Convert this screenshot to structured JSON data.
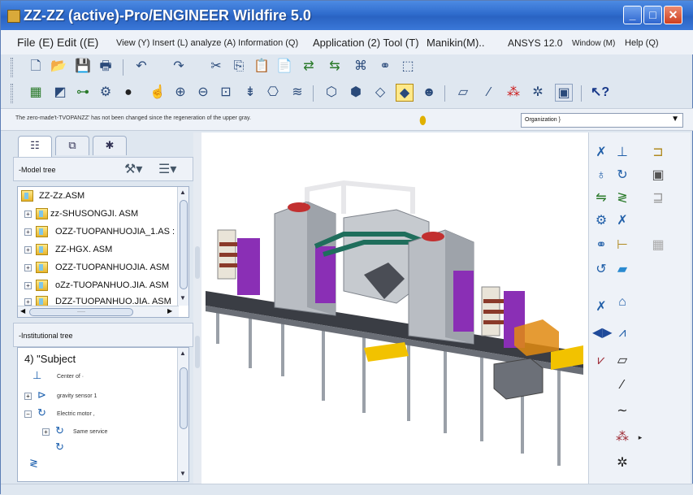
{
  "window": {
    "title": "ZZ-ZZ (active)-Pro/ENGINEER Wildfire 5.0",
    "minimize_label": "_",
    "maximize_label": "□",
    "close_label": "✕"
  },
  "menu": [
    "File (E) Edit ((E)",
    "View (Y) Insert (L) analyze (A) Information (Q)",
    "Application (2) Tool (T)",
    "Manikin(M)..",
    "ANSYS 12.0",
    "Window (M)",
    "Help (Q)"
  ],
  "message": "The zero-made't-TVOPANZZ' has not been changed since the regeneration of the upper gray.",
  "filter": {
    "value": "Organization }",
    "arrow": "▼"
  },
  "panel_tabs": [
    "model-tree-tab",
    "layer-tab",
    "favorites-tab"
  ],
  "model_tree": {
    "header": "-Model tree",
    "root": "ZZ-Zz.ASM",
    "items": [
      "zz-SHUSONGJI. ASM",
      "OZZ-TUOPANHUOJIA_1.AS :",
      "ZZ-HGX. ASM",
      "OZZ-TUOPANHUOJIA. ASM",
      "oZz-TUOPANHUO.JIA. ASM",
      "DZZ-TUOPANHUO.JIA. ASM"
    ],
    "hscroll_label": "·····"
  },
  "inst_tree": {
    "header": "-Institutional tree",
    "root": "4) \"Subject",
    "items": [
      "Center of ·",
      "gravity sensor 1",
      "Electric motor ,",
      "Same service"
    ]
  },
  "colors": {
    "titlebar": "#2f6ccd",
    "machine_gray": "#b9bdc3",
    "accent_purple": "#8a2fb5",
    "pipe_green": "#1f6e5c",
    "conveyor": "#3a3d44"
  },
  "toolbar1_icons": [
    "new-icon",
    "open-icon",
    "save-icon",
    "print-icon",
    "undo-icon",
    "redo-icon",
    "cut-icon",
    "copy-icon",
    "paste-icon",
    "paste-special-icon",
    "regenerate-icon",
    "regenerate-manager-icon",
    "find-icon",
    "binoculars-icon",
    "select-box-icon"
  ],
  "toolbar2_icons": [
    "datum-display-icon",
    "repaint-icon",
    "spin-center-icon",
    "orient-icon",
    "shading-icon",
    "pan-icon",
    "zoom-in-icon",
    "zoom-out-icon",
    "refit-icon",
    "saved-views-icon",
    "view-manager-icon",
    "layers-icon",
    "wireframe-icon",
    "hidden-line-icon",
    "no-hidden-icon",
    "shaded-icon",
    "enhanced-realism-icon",
    "datum-plane-icon",
    "datum-axis-icon",
    "datum-point-icon",
    "csys-icon",
    "annotation-icon",
    "whats-this-icon"
  ]
}
